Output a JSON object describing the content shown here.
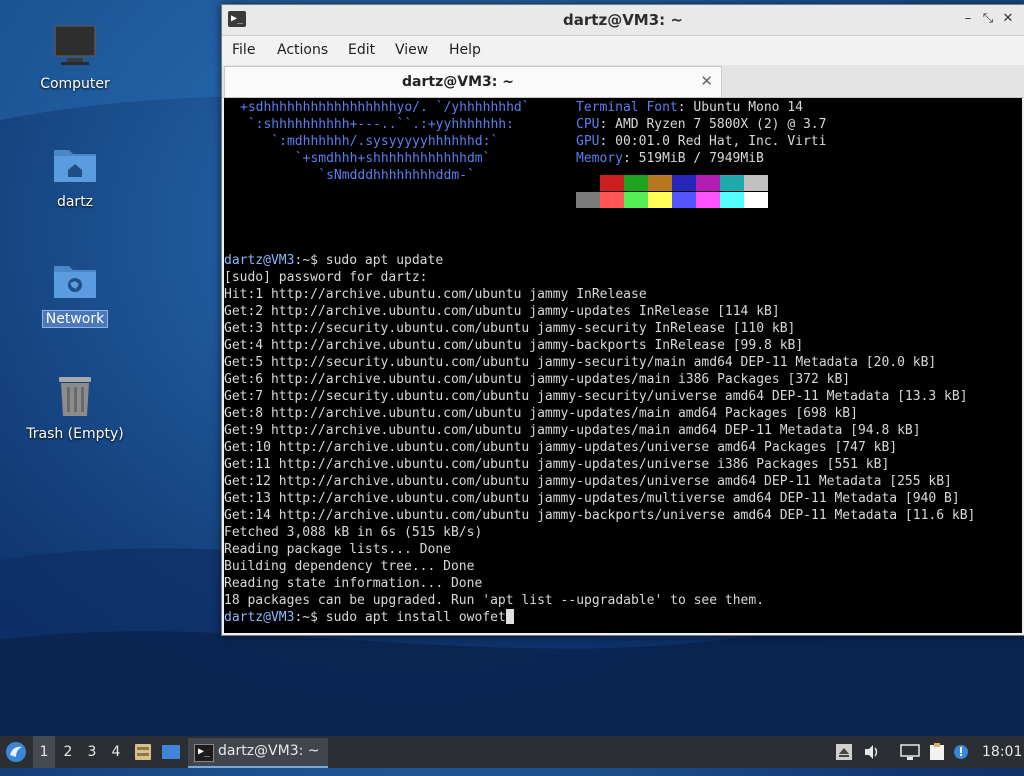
{
  "desktop": {
    "icons": [
      {
        "name": "computer",
        "label": "Computer"
      },
      {
        "name": "home",
        "label": "dartz"
      },
      {
        "name": "network",
        "label": "Network"
      },
      {
        "name": "trash",
        "label": "Trash (Empty)"
      }
    ]
  },
  "window": {
    "title": "dartz@VM3: ~",
    "menu": [
      "File",
      "Actions",
      "Edit",
      "View",
      "Help"
    ],
    "tab_title": "dartz@VM3: ~",
    "icon_glyph": "▶_",
    "controls": {
      "minimize": "–",
      "maximize": "⤡",
      "close": "✕"
    },
    "tab_close": "✕"
  },
  "terminal": {
    "art": [
      "+sdhhhhhhhhhhhhhhhhhyo/. `/yhhhhhhhd`",
      " `:shhhhhhhhhh+---..``.:+yyhhhhhhh:",
      "    `:mdhhhhhh/.sysyyyyyhhhhhhd:`",
      "       `+smdhhh+shhhhhhhhhhhhdm`",
      "          `sNmdddhhhhhhhhddm-`"
    ],
    "info": [
      {
        "key": "Terminal Font",
        "value": "Ubuntu Mono 14"
      },
      {
        "key": "CPU",
        "value": "AMD Ryzen 7 5800X (2) @ 3.7"
      },
      {
        "key": "GPU",
        "value": "00:01.0 Red Hat, Inc. Virti"
      },
      {
        "key": "Memory",
        "value": "519MiB / 7949MiB"
      }
    ],
    "palette_top": [
      "#000000",
      "#cc1e1e",
      "#1ea31e",
      "#b8761e",
      "#2525b8",
      "#b21eb2",
      "#1eaaaa",
      "#c0c0c0"
    ],
    "palette_bottom": [
      "#7a7a7a",
      "#ff5555",
      "#55ee55",
      "#ffff55",
      "#5555ff",
      "#ff55ff",
      "#55ffff",
      "#ffffff"
    ],
    "prompt": "dartz@VM3",
    "prompt_suffix": ":~$ ",
    "command1": "sudo apt update",
    "output": [
      "[sudo] password for dartz:",
      "Hit:1 http://archive.ubuntu.com/ubuntu jammy InRelease",
      "Get:2 http://archive.ubuntu.com/ubuntu jammy-updates InRelease [114 kB]",
      "Get:3 http://security.ubuntu.com/ubuntu jammy-security InRelease [110 kB]",
      "Get:4 http://archive.ubuntu.com/ubuntu jammy-backports InRelease [99.8 kB]",
      "Get:5 http://security.ubuntu.com/ubuntu jammy-security/main amd64 DEP-11 Metadata [20.0 kB]",
      "Get:6 http://archive.ubuntu.com/ubuntu jammy-updates/main i386 Packages [372 kB]",
      "Get:7 http://security.ubuntu.com/ubuntu jammy-security/universe amd64 DEP-11 Metadata [13.3 kB]",
      "Get:8 http://archive.ubuntu.com/ubuntu jammy-updates/main amd64 Packages [698 kB]",
      "Get:9 http://archive.ubuntu.com/ubuntu jammy-updates/main amd64 DEP-11 Metadata [94.8 kB]",
      "Get:10 http://archive.ubuntu.com/ubuntu jammy-updates/universe amd64 Packages [747 kB]",
      "Get:11 http://archive.ubuntu.com/ubuntu jammy-updates/universe i386 Packages [551 kB]",
      "Get:12 http://archive.ubuntu.com/ubuntu jammy-updates/universe amd64 DEP-11 Metadata [255 kB]",
      "Get:13 http://archive.ubuntu.com/ubuntu jammy-updates/multiverse amd64 DEP-11 Metadata [940 B]",
      "Get:14 http://archive.ubuntu.com/ubuntu jammy-backports/universe amd64 DEP-11 Metadata [11.6 kB]",
      "Fetched 3,088 kB in 6s (515 kB/s)",
      "Reading package lists... Done",
      "Building dependency tree... Done",
      "Reading state information... Done",
      "18 packages can be upgraded. Run 'apt list --upgradable' to see them."
    ],
    "command2": "sudo apt install owofet"
  },
  "panel": {
    "workspaces": [
      "1",
      "2",
      "3",
      "4"
    ],
    "active_workspace": "1",
    "task_label": "dartz@VM3: ~",
    "task_icon_glyph": "▶_",
    "clock": "18:01",
    "tray_icons": [
      "eject-icon",
      "volume-icon",
      "network-icon",
      "clipboard-icon",
      "update-notifier-icon"
    ]
  }
}
